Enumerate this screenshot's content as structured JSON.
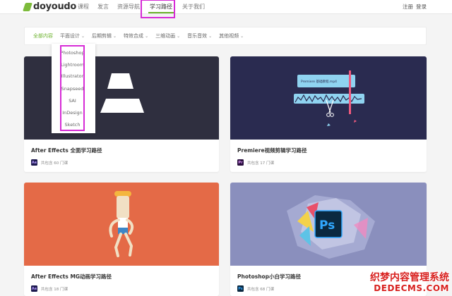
{
  "brand": {
    "logo_text": "doyoudo",
    "accent": "#6bb22c",
    "highlight": "#d62bd6"
  },
  "nav": {
    "items": [
      {
        "label": "课程"
      },
      {
        "label": "发言"
      },
      {
        "label": "资源导航"
      },
      {
        "label": "学习路径",
        "active": true
      },
      {
        "label": "关于我们"
      }
    ]
  },
  "auth": {
    "register": "注册",
    "login": "登录"
  },
  "filter": {
    "items": [
      {
        "label": "全部内容",
        "active": true,
        "has_caret": false
      },
      {
        "label": "平面设计",
        "has_caret": true
      },
      {
        "label": "后期剪辑",
        "has_caret": true
      },
      {
        "label": "特效合成",
        "has_caret": true
      },
      {
        "label": "三维动画",
        "has_caret": true
      },
      {
        "label": "音乐音效",
        "has_caret": true
      },
      {
        "label": "其他视频",
        "has_caret": true
      }
    ],
    "caret": "⌄"
  },
  "dropdown": {
    "items": [
      "Photoshop",
      "Lightroom",
      "Illustrator",
      "Snapseed",
      "SAI",
      "InDesign",
      "Sketch"
    ]
  },
  "cards": [
    {
      "title": "After Effects 全面学习路径",
      "app_icon": "Ae",
      "app_color": "#1d1a4f",
      "meta": "共包含 60 门课",
      "image_bg": "#2f2f3f",
      "image_icon": "ae-mountain-icon"
    },
    {
      "title": "Premiere视频剪辑学习路径",
      "app_icon": "Pr",
      "app_color": "#2a0f3f",
      "meta": "共包含 17 门课",
      "image_bg": "#2a2b50",
      "image_icon": "premiere-timeline-icon",
      "image_clip_label": "Premiere 基础教程.mp4"
    },
    {
      "title": "After Effects MG动画学习路径",
      "app_icon": "Ae",
      "app_color": "#1d1a4f",
      "meta": "共包含 18 门课",
      "image_bg": "#e46a47",
      "image_icon": "mg-character-icon"
    },
    {
      "title": "Photoshop小白学习路径",
      "app_icon": "Ps",
      "app_color": "#0b2940",
      "meta": "共包含 68 门课",
      "image_bg": "#8a8fbd",
      "image_icon": "photoshop-crystal-icon",
      "image_logo": "Ps"
    }
  ],
  "watermark": {
    "line1": "织梦内容管理系统",
    "line2": "DEDECMS.COM"
  }
}
